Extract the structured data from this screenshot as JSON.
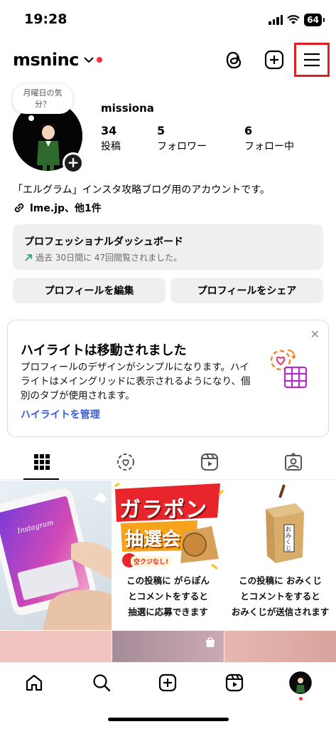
{
  "status_bar": {
    "time": "19:28",
    "battery": "64"
  },
  "header": {
    "username": "msninc",
    "icons": [
      "threads-icon",
      "create-plus-icon",
      "menu-hamburger-icon"
    ]
  },
  "profile": {
    "note": "月曜日の気分？",
    "display_name": "missiona",
    "stats": [
      {
        "value": "34",
        "label": "投稿"
      },
      {
        "value": "5",
        "label": "フォロワー"
      },
      {
        "value": "6",
        "label": "フォロー中"
      }
    ],
    "bio": "「エルグラム」インスタ攻略ブログ用のアカウントです。",
    "link": "lme.jp、他1件"
  },
  "dashboard": {
    "title": "プロフェッショナルダッシュボード",
    "subtitle": "過去 30日間に 47回閲覧されました。"
  },
  "buttons": {
    "edit": "プロフィールを編集",
    "share": "プロフィールをシェア"
  },
  "highlight_card": {
    "title": "ハイライトは移動されました",
    "body": "プロフィールのデザインがシンプルになります。ハイライトはメイングリッドに表示されるようになり、個別のタブが使用されます。",
    "link": "ハイライトを管理"
  },
  "tabs": [
    "grid-icon",
    "reposts-icon",
    "reels-icon",
    "tagged-icon"
  ],
  "posts": [
    {
      "type": "photo",
      "image_text": "Instagram"
    },
    {
      "type": "promo",
      "banner_line1": "ガラポン",
      "banner_line2": "抽選会",
      "badge": "空クジなし!",
      "caption": [
        "この投稿に がらぽん",
        "とコメントをすると",
        "抽選に応募できます"
      ]
    },
    {
      "type": "promo",
      "box_label": "おみくじ",
      "caption": [
        "この投稿に おみくじ",
        "とコメントをすると",
        "おみくじが送信されます"
      ]
    }
  ],
  "colors": {
    "accent_red": "#e01e24",
    "link_blue": "#3b5bdb",
    "notification": "#ff2d42",
    "trend_green": "#1aa260"
  },
  "bottom_nav": [
    "home-icon",
    "search-icon",
    "create-icon",
    "reels-icon",
    "profile-avatar"
  ]
}
